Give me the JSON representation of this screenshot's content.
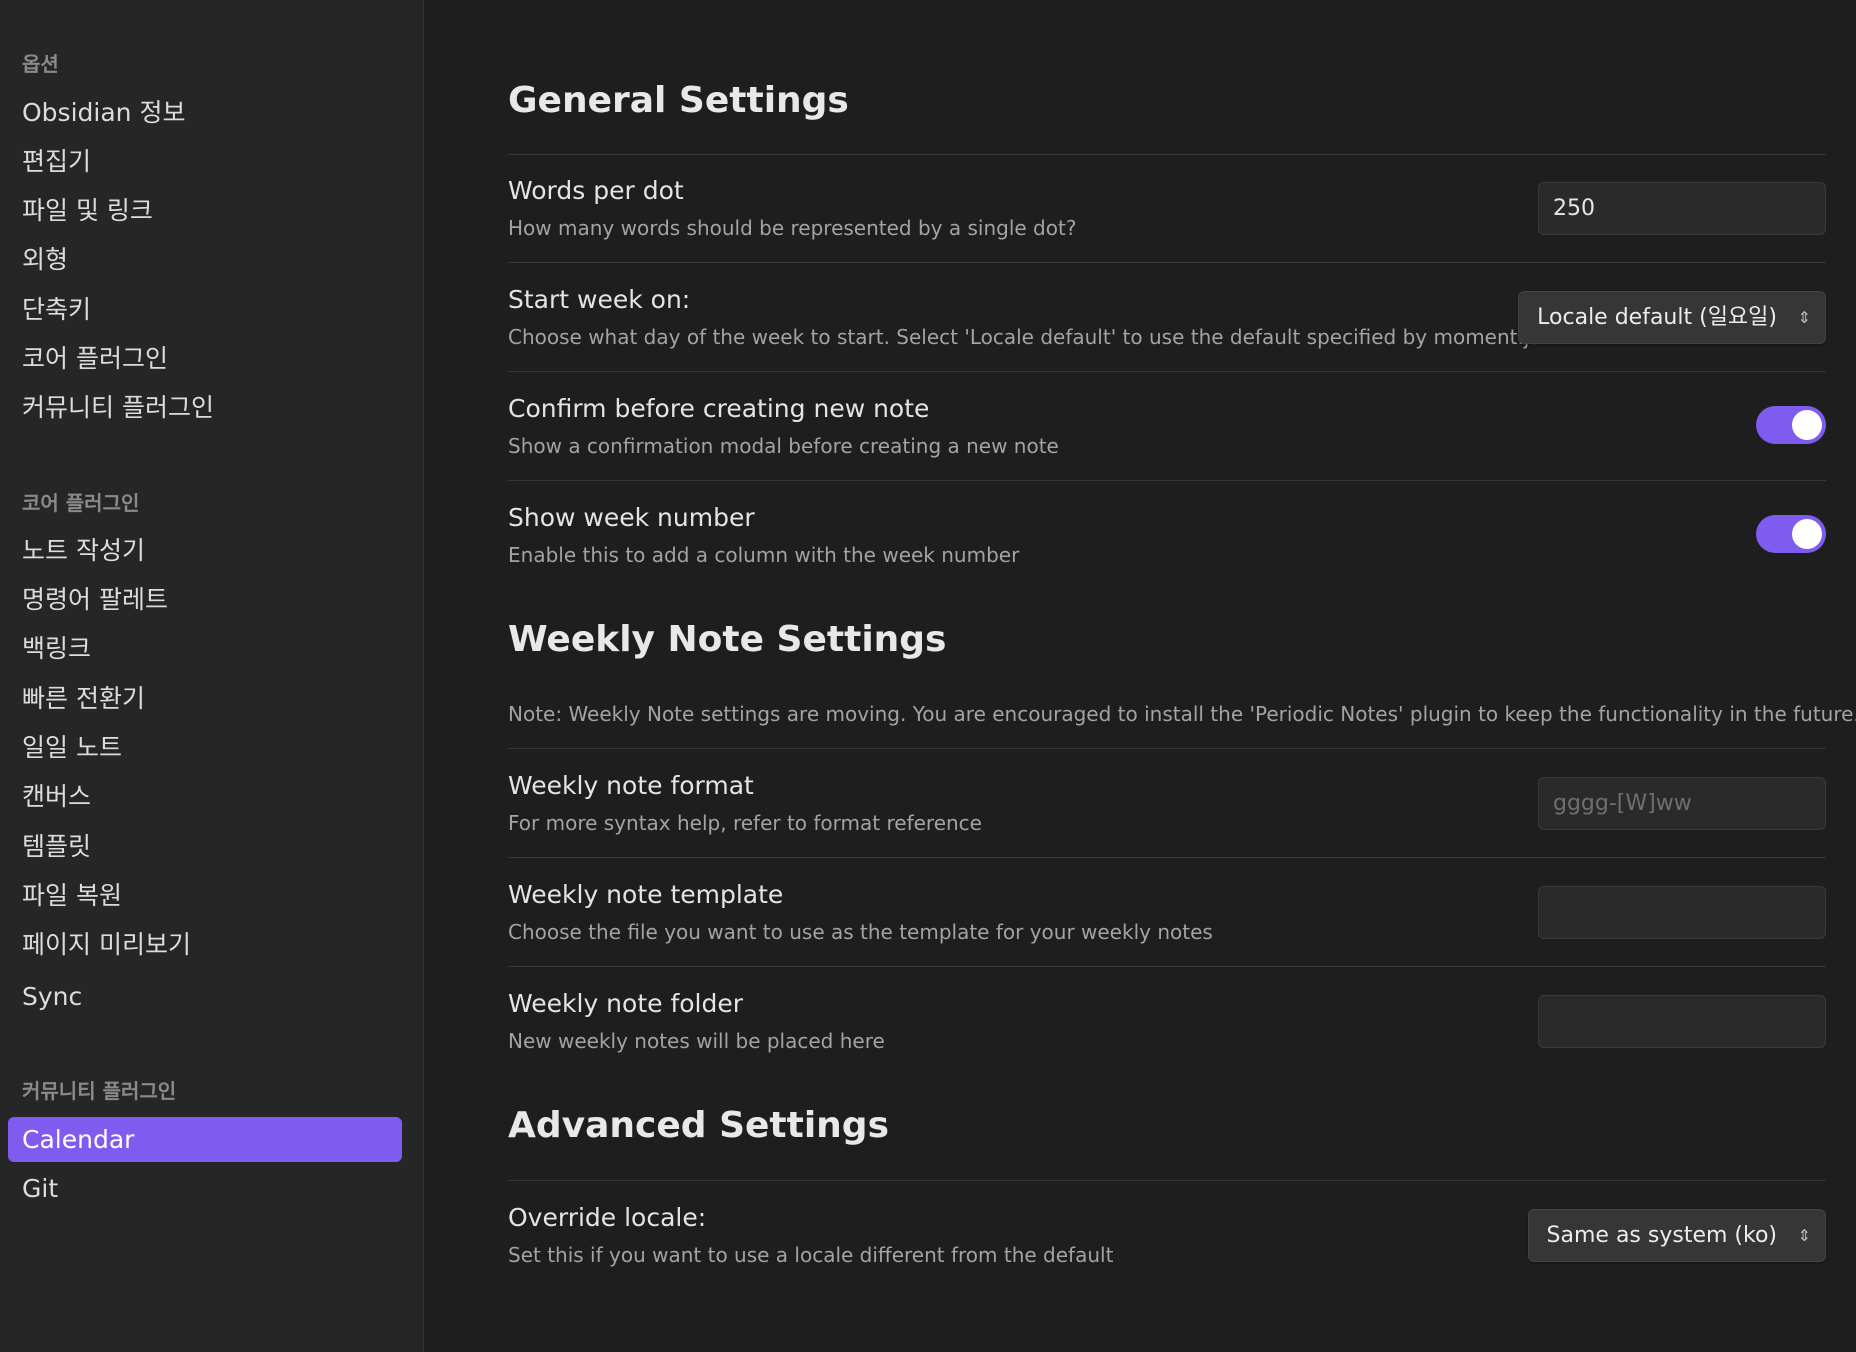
{
  "sidebar": {
    "group_options": "옵션",
    "options_items": [
      {
        "label": "Obsidian 정보"
      },
      {
        "label": "편집기"
      },
      {
        "label": "파일 및 링크"
      },
      {
        "label": "외형"
      },
      {
        "label": "단축키"
      },
      {
        "label": "코어 플러그인"
      },
      {
        "label": "커뮤니티 플러그인"
      }
    ],
    "group_core": "코어 플러그인",
    "core_items": [
      {
        "label": "노트 작성기"
      },
      {
        "label": "명령어 팔레트"
      },
      {
        "label": "백링크"
      },
      {
        "label": "빠른 전환기"
      },
      {
        "label": "일일 노트"
      },
      {
        "label": "캔버스"
      },
      {
        "label": "템플릿"
      },
      {
        "label": "파일 복원"
      },
      {
        "label": "페이지 미리보기"
      },
      {
        "label": "Sync"
      }
    ],
    "group_community": "커뮤니티 플러그인",
    "community_items": [
      {
        "label": "Calendar",
        "active": true
      },
      {
        "label": "Git"
      }
    ]
  },
  "main": {
    "general": {
      "heading": "General Settings",
      "words_per_dot": {
        "name": "Words per dot",
        "desc": "How many words should be represented by a single dot?",
        "value": "250"
      },
      "start_week": {
        "name": "Start week on:",
        "desc": "Choose what day of the week to start. Select 'Locale default' to use the default specified by moment.js",
        "selected": "Locale default (일요일)"
      },
      "confirm_new_note": {
        "name": "Confirm before creating new note",
        "desc": "Show a confirmation modal before creating a new note",
        "enabled": true
      },
      "show_week_number": {
        "name": "Show week number",
        "desc": "Enable this to add a column with the week number",
        "enabled": true
      }
    },
    "weekly": {
      "heading": "Weekly Note Settings",
      "note": "Note: Weekly Note settings are moving. You are encouraged to install the 'Periodic Notes' plugin to keep the functionality in the future.",
      "format": {
        "name": "Weekly note format",
        "desc": "For more syntax help, refer to format reference",
        "value": "",
        "placeholder": "gggg-[W]ww"
      },
      "template": {
        "name": "Weekly note template",
        "desc": "Choose the file you want to use as the template for your weekly notes",
        "value": ""
      },
      "folder": {
        "name": "Weekly note folder",
        "desc": "New weekly notes will be placed here",
        "value": ""
      }
    },
    "advanced": {
      "heading": "Advanced Settings",
      "override_locale": {
        "name": "Override locale:",
        "desc": "Set this if you want to use a locale different from the default",
        "selected": "Same as system (ko)"
      }
    }
  },
  "colors": {
    "accent": "#7f5bf0",
    "background": "#1e1e1e",
    "sidebar_background": "#262626"
  },
  "icons": {
    "select_chevron": "chevron-up-down-icon"
  }
}
